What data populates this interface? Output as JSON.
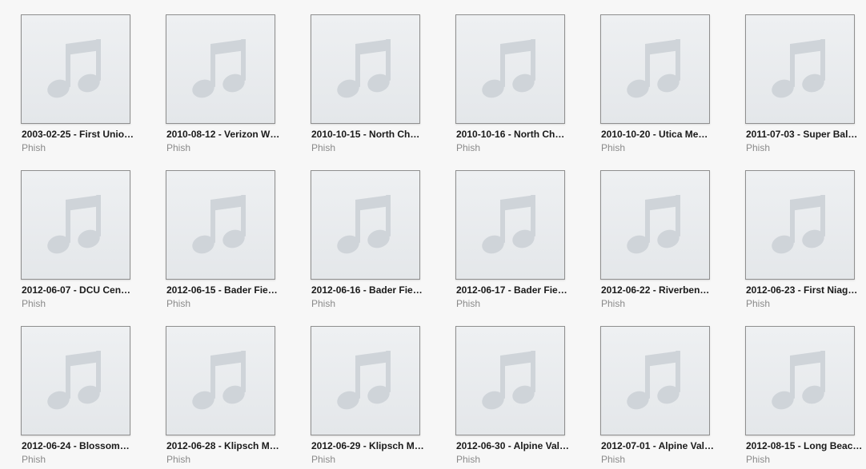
{
  "albums": [
    {
      "title": "2003-02-25 - First Unio…",
      "artist": "Phish",
      "icon": "music-note-icon"
    },
    {
      "title": "2010-08-12 - Verizon W…",
      "artist": "Phish",
      "icon": "music-note-icon"
    },
    {
      "title": "2010-10-15 - North Ch…",
      "artist": "Phish",
      "icon": "music-note-icon"
    },
    {
      "title": "2010-10-16 - North Ch…",
      "artist": "Phish",
      "icon": "music-note-icon"
    },
    {
      "title": "2010-10-20 - Utica Me…",
      "artist": "Phish",
      "icon": "music-note-icon"
    },
    {
      "title": "2011-07-03 - Super Bal…",
      "artist": "Phish",
      "icon": "music-note-icon"
    },
    {
      "title": "2012-06-07 - DCU Cen…",
      "artist": "Phish",
      "icon": "music-note-icon"
    },
    {
      "title": "2012-06-15 - Bader Fie…",
      "artist": "Phish",
      "icon": "music-note-icon"
    },
    {
      "title": "2012-06-16 - Bader Fie…",
      "artist": "Phish",
      "icon": "music-note-icon"
    },
    {
      "title": "2012-06-17 - Bader Fie…",
      "artist": "Phish",
      "icon": "music-note-icon"
    },
    {
      "title": "2012-06-22 - Riverben…",
      "artist": "Phish",
      "icon": "music-note-icon"
    },
    {
      "title": "2012-06-23 - First Niag…",
      "artist": "Phish",
      "icon": "music-note-icon"
    },
    {
      "title": "2012-06-24 - Blossom…",
      "artist": "Phish",
      "icon": "music-note-icon"
    },
    {
      "title": "2012-06-28 - Klipsch M…",
      "artist": "Phish",
      "icon": "music-note-icon"
    },
    {
      "title": "2012-06-29 - Klipsch M…",
      "artist": "Phish",
      "icon": "music-note-icon"
    },
    {
      "title": "2012-06-30 - Alpine Val…",
      "artist": "Phish",
      "icon": "music-note-icon"
    },
    {
      "title": "2012-07-01 - Alpine Val…",
      "artist": "Phish",
      "icon": "music-note-icon"
    },
    {
      "title": "2012-08-15 - Long Beac…",
      "artist": "Phish",
      "icon": "music-note-icon"
    }
  ],
  "colors": {
    "background": "#f7f7f7",
    "artwork_placeholder": "#e6e9ec",
    "note_glyph": "#cfd4d9",
    "title_text": "#1a1a1a",
    "artist_text": "#8a8a8a"
  }
}
